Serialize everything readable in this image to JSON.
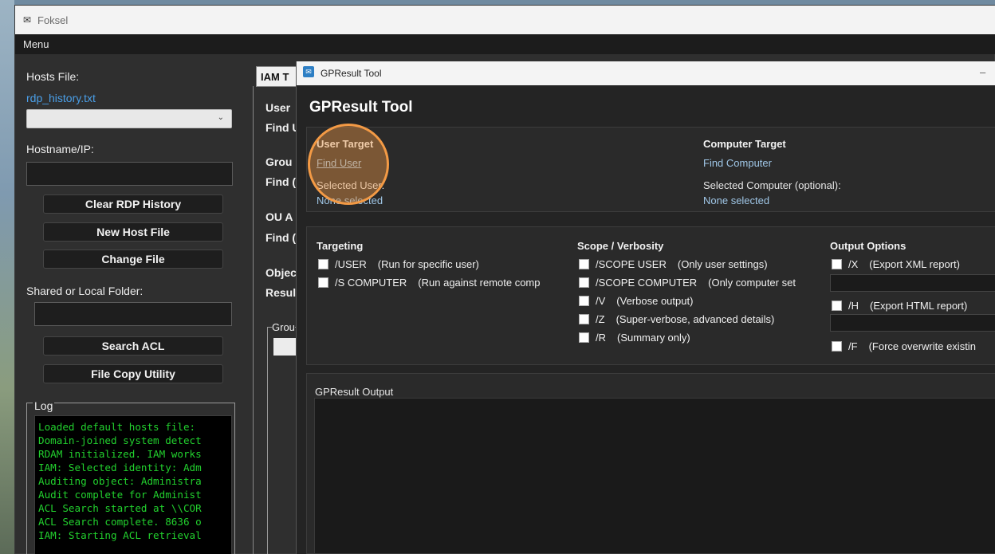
{
  "app": {
    "title": "Foksel",
    "menu_label": "Menu"
  },
  "left_panel": {
    "hosts_file_label": "Hosts File:",
    "hosts_file_name": "rdp_history.txt",
    "hostname_label": "Hostname/IP:",
    "buttons": {
      "clear_rdp": "Clear RDP History",
      "new_host_file": "New Host File",
      "change_file": "Change File",
      "search_acl": "Search ACL",
      "file_copy": "File Copy Utility"
    },
    "shared_folder_label": "Shared or Local Folder:",
    "log_title": "Log",
    "log_lines": [
      "Loaded default hosts file:",
      "Domain-joined system detect",
      "RDAM initialized. IAM works",
      "IAM: Selected identity: Adm",
      "Auditing object: Administra",
      "Audit complete for Administ",
      "ACL Search started at \\\\COR",
      "ACL Search complete. 8636 o",
      "IAM: Starting ACL retrieval"
    ]
  },
  "iam_panel": {
    "tab_label": "IAM T",
    "rows": [
      "User ",
      "Find U",
      "Grou",
      "Find (",
      "OU A",
      "Find (",
      "Objec",
      "Resul"
    ],
    "group_label": "Grou"
  },
  "dialog": {
    "title": "GPResult Tool",
    "heading": "GPResult Tool",
    "minimize": "–",
    "user_target": {
      "title": "User Target",
      "find_link": "Find User",
      "selected_label": "Selected User:",
      "selected_value": "None selected"
    },
    "computer_target": {
      "title": "Computer Target",
      "find_link": "Find Computer",
      "selected_label": "Selected Computer (optional):",
      "selected_value": "None selected"
    },
    "targeting": {
      "title": "Targeting",
      "options": [
        {
          "flag": "/USER",
          "desc": "(Run for specific user)"
        },
        {
          "flag": "/S COMPUTER",
          "desc": "(Run against remote comp"
        }
      ]
    },
    "scope": {
      "title": "Scope / Verbosity",
      "options": [
        {
          "flag": "/SCOPE USER",
          "desc": "(Only user settings)"
        },
        {
          "flag": "/SCOPE COMPUTER",
          "desc": "(Only computer set"
        },
        {
          "flag": "/V",
          "desc": "(Verbose output)"
        },
        {
          "flag": "/Z",
          "desc": "(Super-verbose, advanced details)"
        },
        {
          "flag": "/R",
          "desc": "(Summary only)"
        }
      ]
    },
    "output_options": {
      "title": "Output Options",
      "x": {
        "flag": "/X",
        "desc": "(Export XML report)"
      },
      "h": {
        "flag": "/H",
        "desc": "(Export HTML report)"
      },
      "f": {
        "flag": "/F",
        "desc": "(Force overwrite existin"
      }
    },
    "output_title": "GPResult Output"
  },
  "colors": {
    "accent_link": "#4a9fe8",
    "log_text": "#22d12e",
    "highlight": "#f39a45"
  }
}
